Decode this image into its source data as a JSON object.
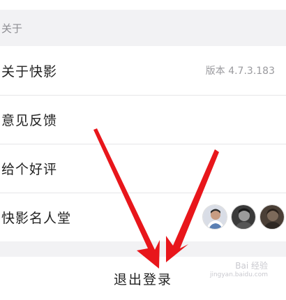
{
  "section": {
    "title": "关于"
  },
  "rows": [
    {
      "label": "关于快影",
      "value": "版本 4.7.3.183"
    },
    {
      "label": "意见反馈"
    },
    {
      "label": "给个好评"
    },
    {
      "label": "快影名人堂"
    }
  ],
  "logout": {
    "label": "退出登录"
  },
  "watermark": {
    "brand": "Bai 经验",
    "url": "jingyan.baidu.com"
  },
  "colors": {
    "background": "#f2f2f4",
    "row": "#ffffff",
    "arrow": "#e8161b"
  },
  "icons": [
    "avatar-1",
    "avatar-2",
    "avatar-3",
    "red-arrow"
  ]
}
